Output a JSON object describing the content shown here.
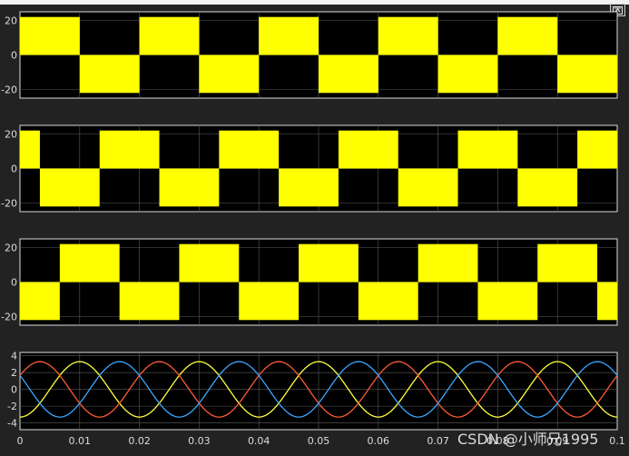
{
  "window": {
    "dock_icon": "undock-icon"
  },
  "colors": {
    "background": "#222222",
    "plot_bg": "#000000",
    "grid": "#5a5a5a",
    "axis": "#dcdcdc",
    "pulse": "#ffff00",
    "phase_a": "#ffff3d",
    "phase_b": "#ff5a36",
    "phase_c": "#3aa6ff"
  },
  "watermark": "CSDN @小师兄1995",
  "chart_data": [
    {
      "type": "line",
      "description": "PWM pulse waveform, phase 1",
      "y_ticks": [
        "20",
        "0",
        "-20"
      ],
      "ylim": [
        -25,
        25
      ],
      "xlim": [
        0,
        0.1
      ],
      "amplitude": 22,
      "period": 0.02,
      "phase_shift_deg": 0
    },
    {
      "type": "line",
      "description": "PWM pulse waveform, phase 2",
      "y_ticks": [
        "20",
        "0",
        "-20"
      ],
      "ylim": [
        -25,
        25
      ],
      "xlim": [
        0,
        0.1
      ],
      "amplitude": 22,
      "period": 0.02,
      "phase_shift_deg": -120
    },
    {
      "type": "line",
      "description": "PWM pulse waveform, phase 3",
      "y_ticks": [
        "20",
        "0",
        "-20"
      ],
      "ylim": [
        -25,
        25
      ],
      "xlim": [
        0,
        0.1
      ],
      "amplitude": 22,
      "period": 0.02,
      "phase_shift_deg": 120
    },
    {
      "type": "line",
      "description": "three-phase sinusoidal currents",
      "y_ticks": [
        "4",
        "2",
        "0",
        "-2",
        "-4"
      ],
      "ylim": [
        -4.8,
        4.4
      ],
      "xlim": [
        0,
        0.1
      ],
      "x_ticks": [
        "0",
        "0.01",
        "0.02",
        "0.03",
        "0.04",
        "0.05",
        "0.06",
        "0.07",
        "0.08",
        "0.09",
        "0.1"
      ],
      "series": [
        {
          "color": "#ffff3d",
          "amplitude": 3.3,
          "period": 0.02,
          "phase_deg": 270
        },
        {
          "color": "#ff5a36",
          "amplitude": 3.3,
          "period": 0.02,
          "phase_deg": 30
        },
        {
          "color": "#3aa6ff",
          "amplitude": 3.3,
          "period": 0.02,
          "phase_deg": 150
        }
      ]
    }
  ]
}
